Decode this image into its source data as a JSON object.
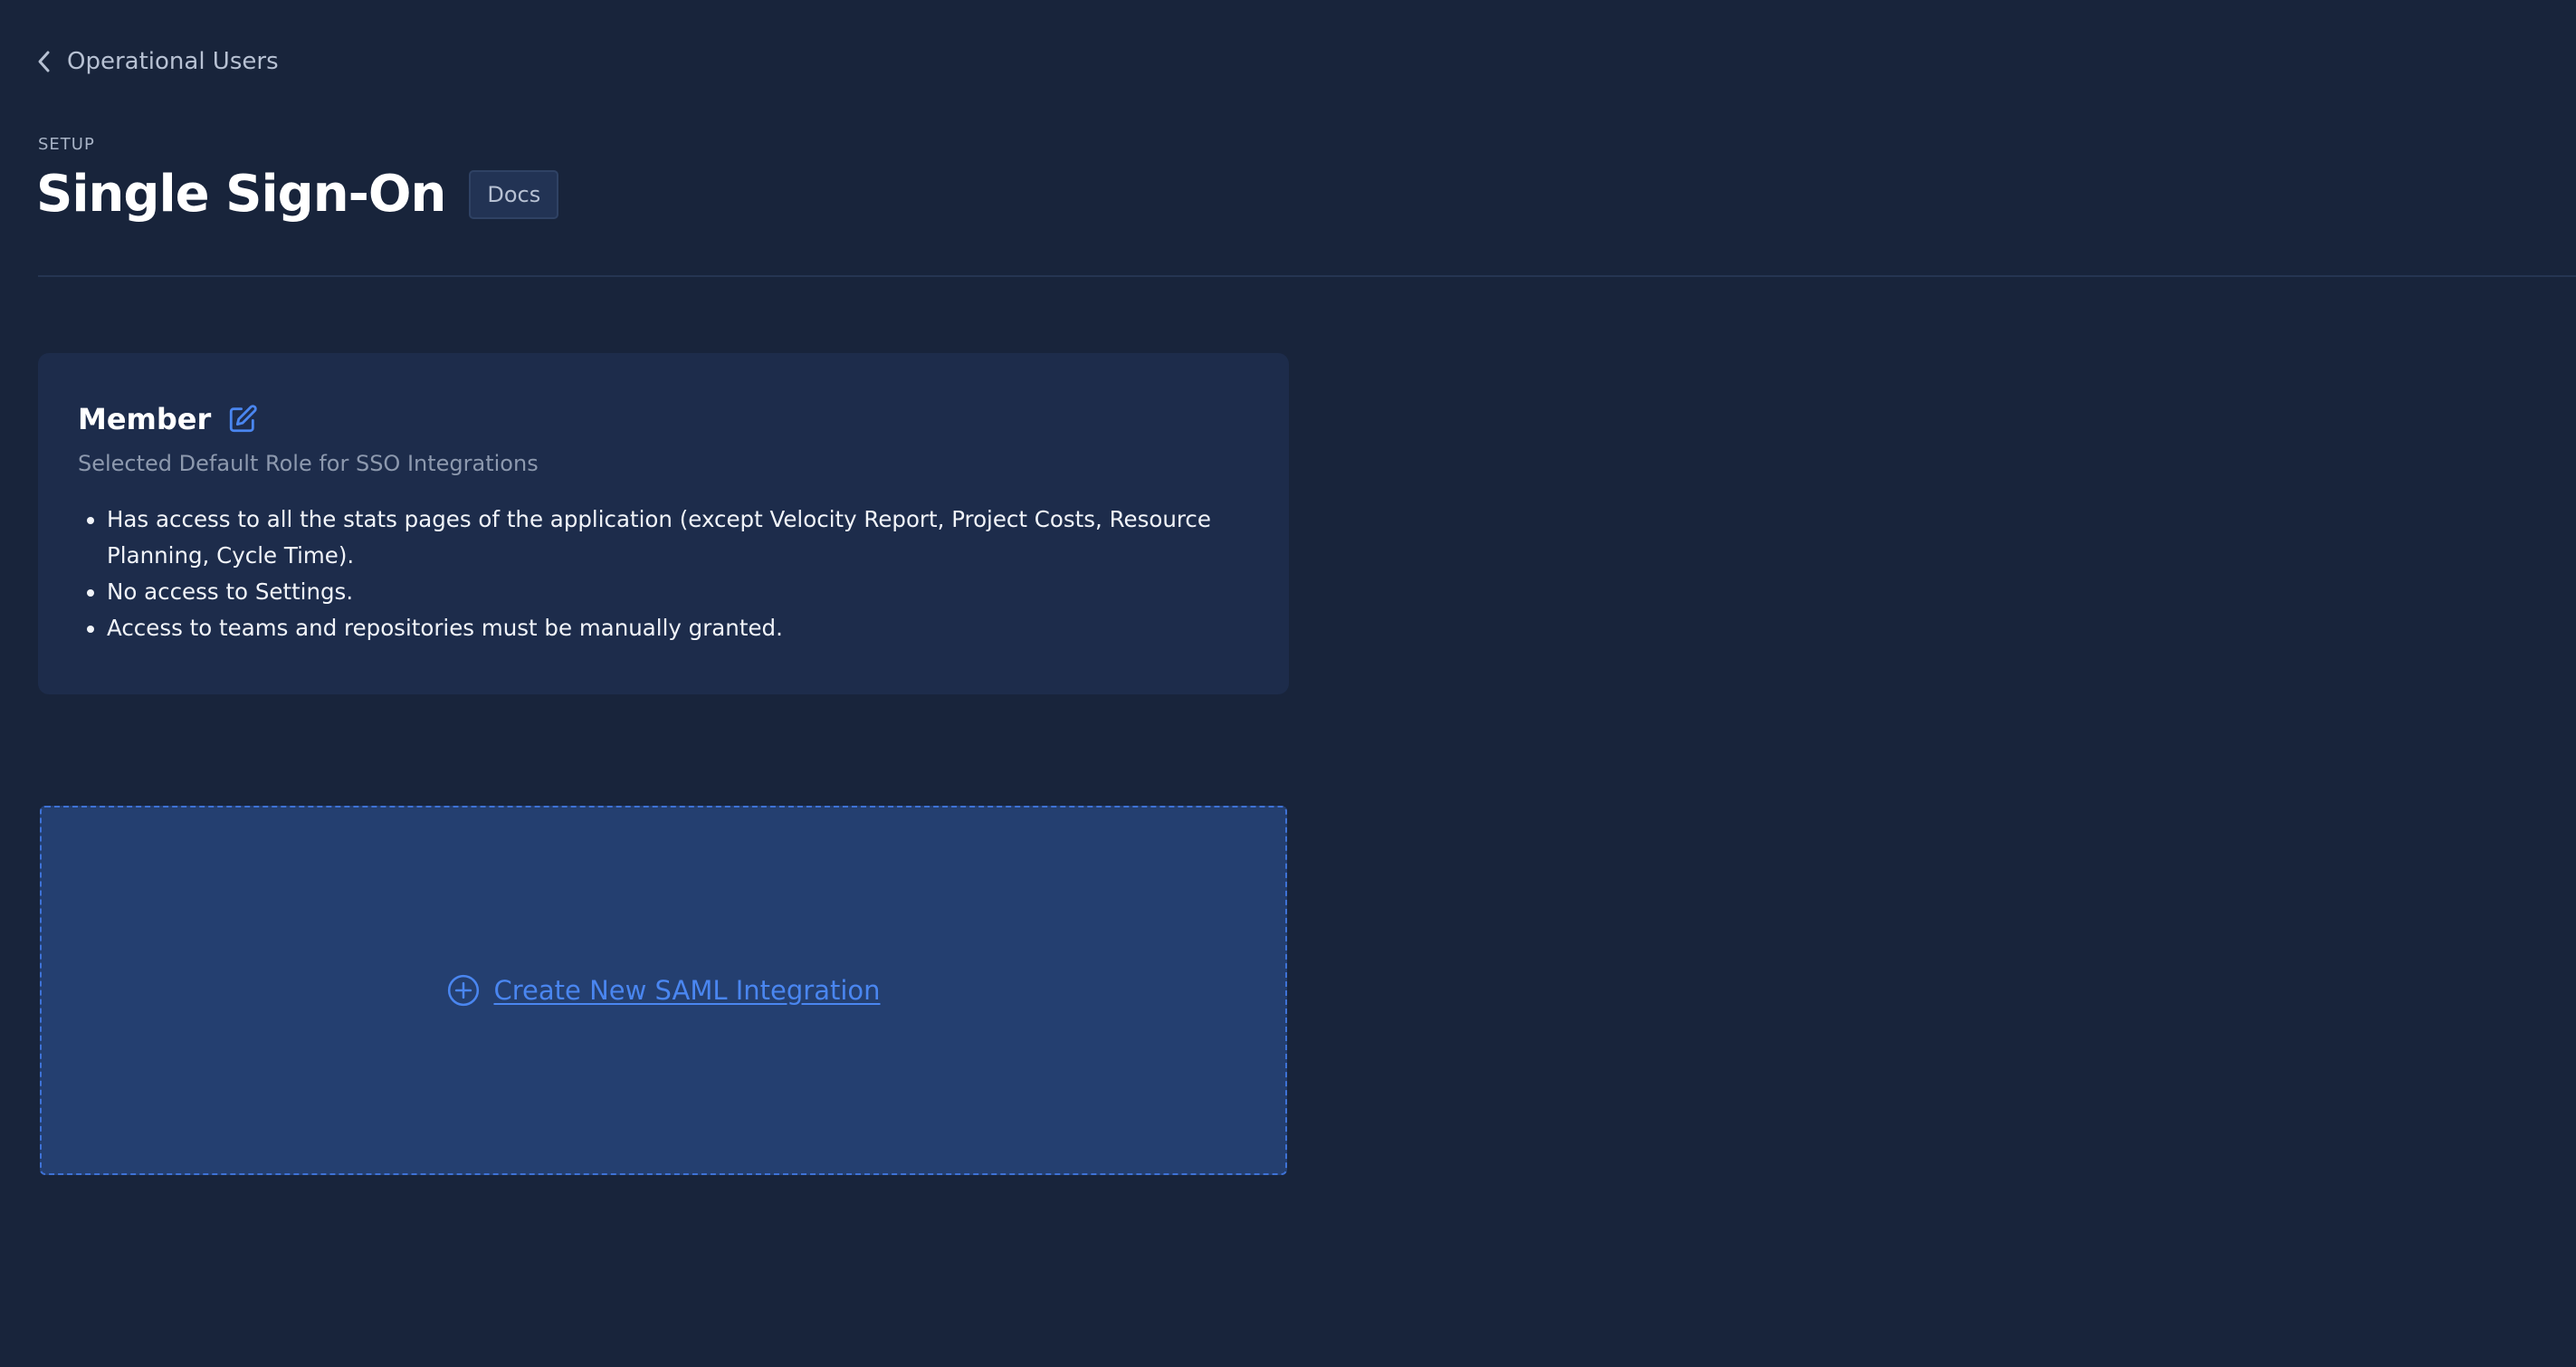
{
  "breadcrumb": {
    "label": "Operational Users",
    "icon": "chevron-left-icon"
  },
  "header": {
    "eyebrow": "SETUP",
    "title": "Single Sign-On",
    "docs_label": "Docs"
  },
  "role_card": {
    "name": "Member",
    "edit_icon": "edit-icon",
    "subtitle": "Selected Default Role for SSO Integrations",
    "permissions": [
      "Has access to all the stats pages of the application (except Velocity Report, Project Costs, Resource Planning, Cycle Time).",
      "No access to Settings.",
      "Access to teams and repositories must be manually granted."
    ]
  },
  "saml": {
    "create_label": "Create New SAML Integration",
    "icon": "plus-circle-icon"
  },
  "colors": {
    "background": "#18243b",
    "card": "#1d2c4b",
    "saml_box": "#243f70",
    "accent": "#4a86f0"
  }
}
